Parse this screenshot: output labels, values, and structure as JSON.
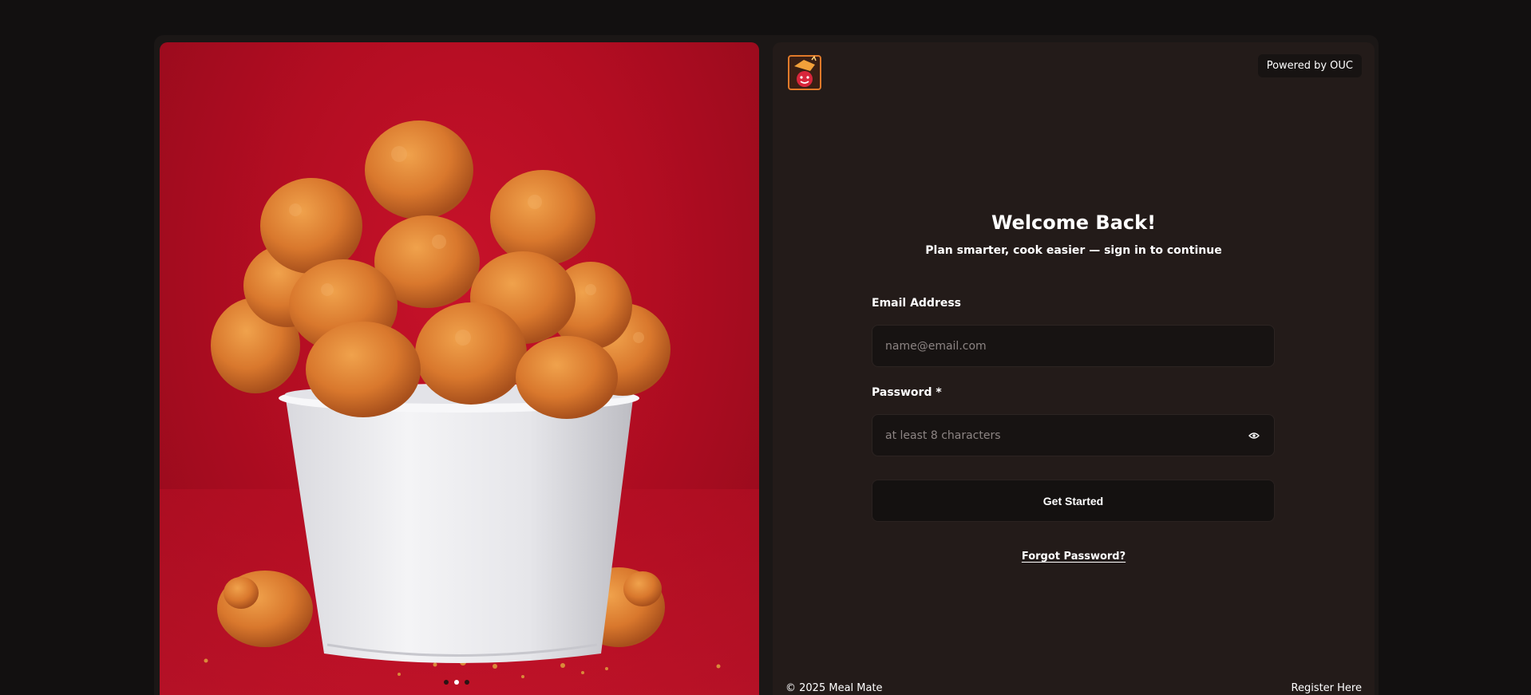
{
  "brand": {
    "powered_by": "Powered by OUC",
    "copyright": "© 2025 Meal Mate"
  },
  "hero": {
    "image": "fried-chicken-bucket",
    "slides": 3,
    "active_slide": 2
  },
  "login": {
    "title": "Welcome Back!",
    "subtitle": "Plan smarter, cook easier — sign in to continue",
    "email_label": "Email Address",
    "email_placeholder": "name@email.com",
    "email_value": "",
    "password_label": "Password *",
    "password_placeholder": "at least 8 characters",
    "password_value": "",
    "submit_label": "Get Started",
    "forgot_label": "Forgot Password?",
    "register_label": "Register Here"
  },
  "colors": {
    "background": "#121010",
    "panel": "#231b19",
    "input": "#171312",
    "hero_red": "#b30d22"
  }
}
